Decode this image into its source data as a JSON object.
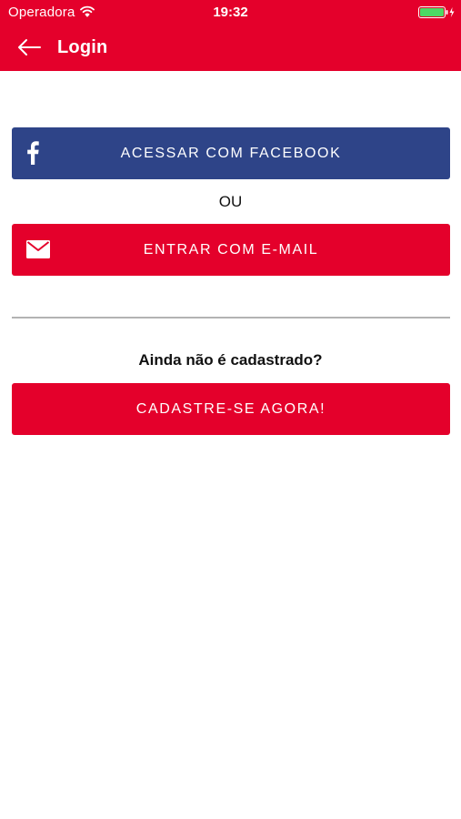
{
  "status_bar": {
    "carrier": "Operadora",
    "time": "19:32",
    "icons": [
      "wifi-icon",
      "battery-charging-icon"
    ]
  },
  "nav": {
    "title": "Login",
    "back_icon": "arrow-left-icon"
  },
  "login": {
    "facebook_button": "ACESSAR COM FACEBOOK",
    "or_separator": "OU",
    "email_button": "ENTRAR COM E-MAIL"
  },
  "signup": {
    "question": "Ainda não é cadastrado?",
    "button": "CADASTRE-SE AGORA!"
  },
  "colors": {
    "primary_red": "#e4002b",
    "facebook_blue": "#2e4488",
    "battery_green": "#4cd964",
    "divider_gray": "#b3b3b3"
  }
}
